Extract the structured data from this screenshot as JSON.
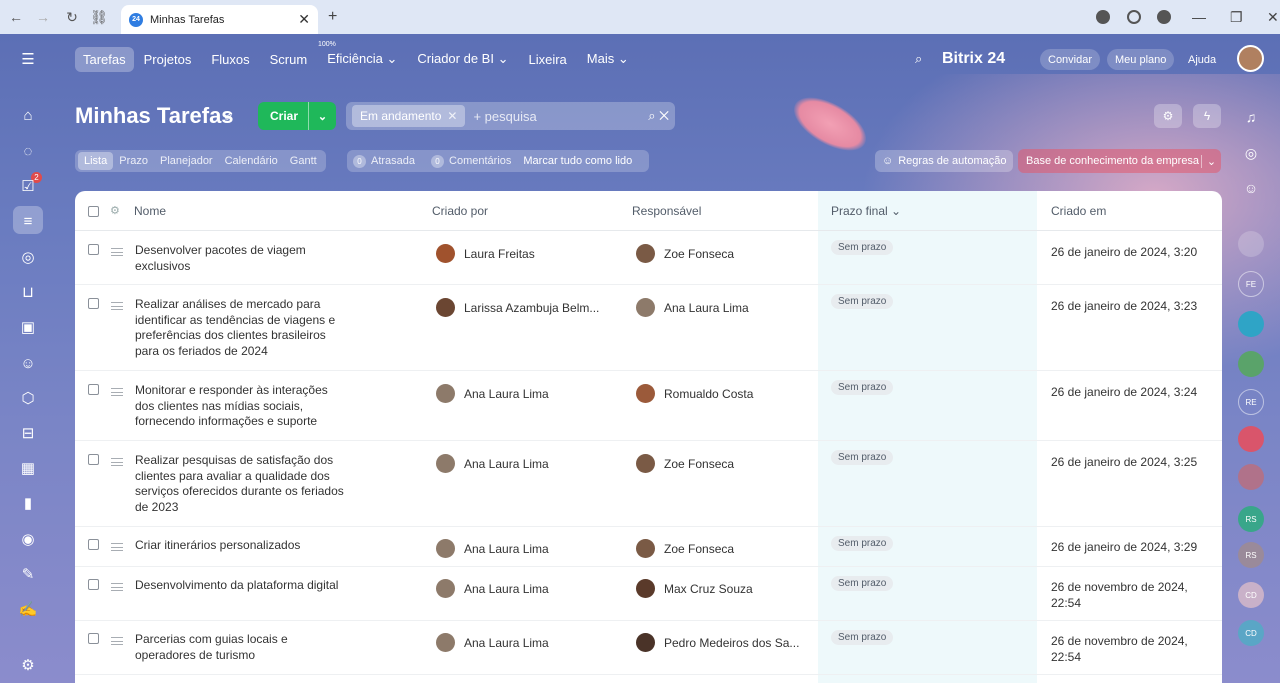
{
  "browser": {
    "tab_title": "Minhas Tarefas",
    "favicon_text": "24"
  },
  "topmenu": {
    "items": [
      "Tarefas",
      "Projetos",
      "Fluxos",
      "Scrum",
      "Eficiência",
      "Criador de BI",
      "Lixeira",
      "Mais"
    ],
    "efficiency_badge": "100%",
    "logo": "Bitrix 24",
    "invite": "Convidar",
    "plan": "Meu plano",
    "help": "Ajuda"
  },
  "header": {
    "title": "Minhas Tarefas",
    "create_label": "Criar",
    "filter_chip": "Em andamento",
    "search_placeholder": "+ pesquisa"
  },
  "views": [
    "Lista",
    "Prazo",
    "Planejador",
    "Calendário",
    "Gantt"
  ],
  "counters": {
    "overdue_count": "0",
    "overdue_label": "Atrasada",
    "comments_count": "0",
    "comments_label": "Comentários",
    "mark_all": "Marcar tudo como lido"
  },
  "automation_label": "Regras de automação",
  "knowledge_base_label": "Base de conhecimento da empresa",
  "left_badge": "2",
  "right_bar": [
    "FE",
    "RE",
    "RS",
    "RS",
    "CD",
    "CD"
  ],
  "table": {
    "headers": {
      "name": "Nome",
      "created_by": "Criado por",
      "responsible": "Responsável",
      "deadline": "Prazo final",
      "created_on": "Criado em"
    },
    "rows": [
      {
        "name": "Desenvolver pacotes de viagem exclusivos",
        "created_by": "Laura Freitas",
        "responsible": "Zoe Fonseca",
        "deadline": "Sem prazo",
        "created_on": "26 de janeiro de 2024, 3:20"
      },
      {
        "name": "Realizar análises de mercado para identificar as tendências de viagens e preferências dos clientes brasileiros para os feriados de 2024",
        "created_by": "Larissa Azambuja Belm...",
        "responsible": "Ana Laura Lima",
        "deadline": "Sem prazo",
        "created_on": "26 de janeiro de 2024, 3:23"
      },
      {
        "name": "Monitorar e responder às interações dos clientes nas mídias sociais, fornecendo informações e suporte",
        "created_by": "Ana Laura Lima",
        "responsible": "Romualdo Costa",
        "deadline": "Sem prazo",
        "created_on": "26 de janeiro de 2024, 3:24"
      },
      {
        "name": "Realizar pesquisas de satisfação dos clientes para avaliar a qualidade dos serviços oferecidos durante os feriados de 2023",
        "created_by": "Ana Laura Lima",
        "responsible": "Zoe Fonseca",
        "deadline": "Sem prazo",
        "created_on": "26 de janeiro de 2024, 3:25"
      },
      {
        "name": "Criar itinerários personalizados",
        "created_by": "Ana Laura Lima",
        "responsible": "Zoe Fonseca",
        "deadline": "Sem prazo",
        "created_on": "26 de janeiro de 2024, 3:29"
      },
      {
        "name": "Desenvolvimento da plataforma digital",
        "created_by": "Ana Laura Lima",
        "responsible": "Max Cruz Souza",
        "deadline": "Sem prazo",
        "created_on": "26 de novembro de 2024, 22:54"
      },
      {
        "name": "Parcerias com guias locais e operadores de turismo",
        "created_by": "Ana Laura Lima",
        "responsible": "Pedro Medeiros dos Sa...",
        "deadline": "Sem prazo",
        "created_on": "26 de novembro de 2024, 22:54"
      }
    ]
  }
}
